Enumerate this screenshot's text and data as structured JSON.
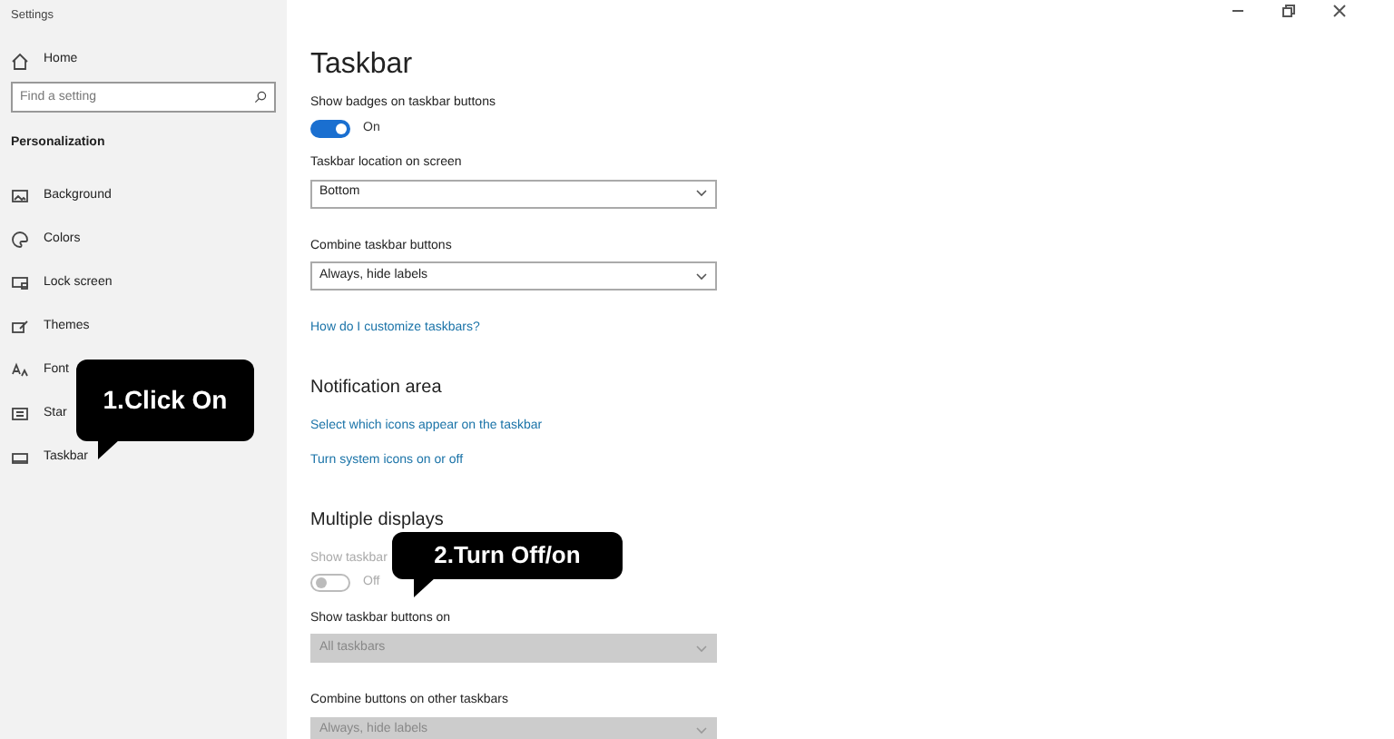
{
  "window": {
    "title": "Settings"
  },
  "sidebar": {
    "home": "Home",
    "search": {
      "placeholder": "Find a setting"
    },
    "section": "Personalization",
    "items": [
      {
        "label": "Background"
      },
      {
        "label": "Colors"
      },
      {
        "label": "Lock screen"
      },
      {
        "label": "Themes"
      },
      {
        "label": "Font"
      },
      {
        "label": "Star"
      },
      {
        "label": "Taskbar"
      }
    ]
  },
  "main": {
    "title": "Taskbar",
    "settings": [
      {
        "kind": "toggle",
        "label": "Show badges on taskbar buttons",
        "on": true,
        "state_text": "On",
        "disabled": false
      },
      {
        "kind": "dropdown",
        "label": "Taskbar location on screen",
        "value": "Bottom",
        "disabled": false
      },
      {
        "kind": "dropdown",
        "label": "Combine taskbar buttons",
        "value": "Always, hide labels",
        "disabled": false
      },
      {
        "kind": "link",
        "text": "How do I customize taskbars?"
      },
      {
        "kind": "heading",
        "text": "Notification area"
      },
      {
        "kind": "link",
        "text": "Select which icons appear on the taskbar"
      },
      {
        "kind": "link",
        "text": "Turn system icons on or off"
      },
      {
        "kind": "heading",
        "text": "Multiple displays"
      },
      {
        "kind": "toggle",
        "label": "Show taskbar",
        "on": false,
        "state_text": "Off",
        "disabled": true
      },
      {
        "kind": "dropdown",
        "label": "Show taskbar buttons on",
        "value": "All taskbars",
        "disabled": true
      },
      {
        "kind": "dropdown",
        "label": "Combine buttons on other taskbars",
        "value": "Always, hide labels",
        "disabled": true
      }
    ]
  },
  "callouts": [
    {
      "text": "1.Click On"
    },
    {
      "text": "2.Turn Off/on"
    }
  ]
}
